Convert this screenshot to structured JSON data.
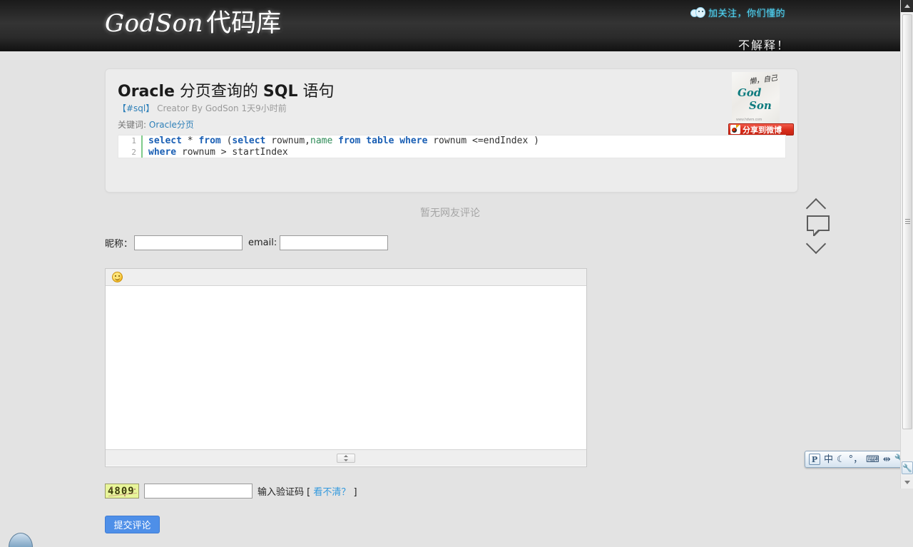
{
  "header": {
    "logo_en": "GodSon",
    "logo_cn": "代码库",
    "follow_text": "加关注，你们懂的",
    "follow_icon": "face-icon",
    "slogan": "不解释！"
  },
  "article": {
    "title_main": "Oracle",
    "title_rest_1": " 分页查询的 ",
    "title_sql": "SQL",
    "title_rest_2": " 语句",
    "tag": "【#sql】",
    "creator": "Creator By GodSon 1天9小时前",
    "keywords_label": "关键词:",
    "keywords_value": "Oracle分页",
    "thumb": {
      "scribble": "懒，自己",
      "line1": "God",
      "line2": "Son",
      "url": "www.hdwm.com"
    },
    "share_label": "分享到微博",
    "code": {
      "lines": [
        {
          "no": "1",
          "parts": [
            {
              "t": "select",
              "c": "kw"
            },
            {
              "t": " * ",
              "c": ""
            },
            {
              "t": "from",
              "c": "kw"
            },
            {
              "t": " (",
              "c": ""
            },
            {
              "t": "select",
              "c": "kw"
            },
            {
              "t": " rownum,",
              "c": ""
            },
            {
              "t": "name",
              "c": "gr"
            },
            {
              "t": " ",
              "c": ""
            },
            {
              "t": "from",
              "c": "kw"
            },
            {
              "t": " ",
              "c": ""
            },
            {
              "t": "table",
              "c": "kw"
            },
            {
              "t": " ",
              "c": ""
            },
            {
              "t": "where",
              "c": "kw"
            },
            {
              "t": " rownum <=endIndex )",
              "c": ""
            }
          ]
        },
        {
          "no": "2",
          "parts": [
            {
              "t": "where",
              "c": "kw"
            },
            {
              "t": " rownum > startIndex",
              "c": ""
            }
          ]
        }
      ]
    }
  },
  "comments": {
    "empty_text": "暂无网友评论",
    "nickname_label": "昵称：",
    "nickname_value": "",
    "email_label": "email:",
    "email_value": "",
    "emoji_icon": "smiley-icon",
    "body_value": "",
    "captcha_code": "4809",
    "captcha_value": "",
    "captcha_label": "输入验证码 [",
    "captcha_refresh": "看不清？",
    "captcha_label_end": "]",
    "submit_label": "提交评论"
  },
  "sidenav": {
    "up_icon": "chevron-up-icon",
    "comment_icon": "speech-bubble-icon",
    "down_icon": "chevron-down-icon"
  },
  "ime": {
    "items": [
      {
        "label": "P",
        "name": "ime-logo-icon"
      },
      {
        "label": "中",
        "name": "ime-chinese-mode-icon"
      },
      {
        "label": "☾",
        "name": "ime-moon-icon"
      },
      {
        "label": "°，",
        "name": "ime-punctuation-icon"
      },
      {
        "label": "⌨",
        "name": "ime-keyboard-icon"
      },
      {
        "label": "⇹",
        "name": "ime-switch-icon"
      },
      {
        "label": "🔧",
        "name": "ime-settings-icon"
      }
    ]
  },
  "scrollbar": {
    "up_icon": "scroll-up-arrow",
    "down_icon": "scroll-down-arrow",
    "tool_icon": "wrench-icon"
  },
  "colors": {
    "accent_blue": "#2d7fb8",
    "link_blue": "#3399dd",
    "share_red": "#d92d1b",
    "submit_blue": "#4e8fe8",
    "keyword_blue": "#1a5fb4",
    "string_green": "#2e8b57",
    "follow_cyan": "#4fd4f5"
  }
}
